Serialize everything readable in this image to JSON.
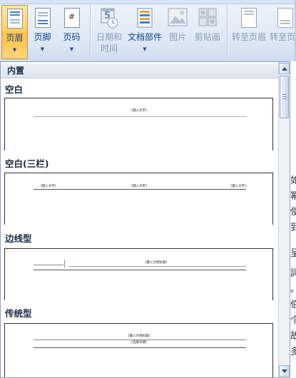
{
  "ribbon": {
    "buttons": [
      {
        "label": "页眉",
        "has_dropdown": true,
        "active": true
      },
      {
        "label": "页脚",
        "has_dropdown": true
      },
      {
        "label": "页码",
        "has_dropdown": true,
        "icon_glyph": "#"
      },
      {
        "label_line1": "日期和",
        "label_line2": "时间",
        "disabled": true,
        "icon_glyph": "5"
      },
      {
        "label": "文档部件",
        "has_dropdown": true
      },
      {
        "label": "图片",
        "disabled": true
      },
      {
        "label": "剪贴画",
        "disabled": true
      },
      {
        "label": "转至页眉",
        "disabled": true
      },
      {
        "label": "转至页",
        "disabled": true
      }
    ],
    "caret": "▼"
  },
  "gallery": {
    "category": "内置",
    "items": [
      {
        "title": "空白",
        "placeholders": [
          "[键入文字]"
        ]
      },
      {
        "title": "空白(三栏)",
        "placeholders": [
          "[键入文字]",
          "[键入文字]",
          "[键入文字]"
        ]
      },
      {
        "title": "边线型",
        "placeholders": [
          "[键入文档标题]"
        ]
      },
      {
        "title": "传统型",
        "placeholders": [
          "[键入文档标题]",
          "[选取日期]"
        ]
      }
    ]
  },
  "background_doc": {
    "chars": [
      "如",
      "幂",
      "使",
      "到",
      "呈",
      "詞",
      "。",
      "伯",
      "个",
      "故",
      "多"
    ]
  },
  "colors": {
    "accent_active": "#ffc040",
    "ribbon_text": "#15428b",
    "disabled_text": "#8a9bb4"
  }
}
